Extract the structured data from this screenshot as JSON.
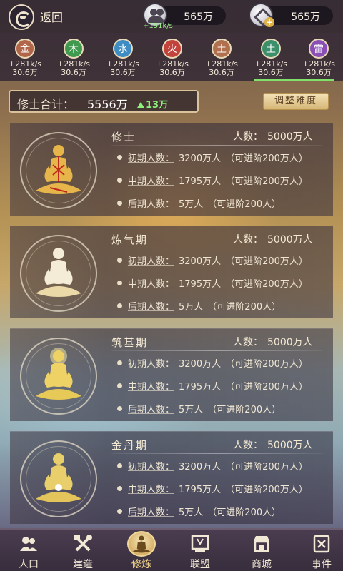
{
  "header": {
    "back_label": "返回",
    "people_value": "565万",
    "people_rate": "+151k/s",
    "coin_value": "565万"
  },
  "elements": [
    {
      "glyph": "金",
      "rate": "+281k/s",
      "value": "30.6万",
      "color": "#b1664a"
    },
    {
      "glyph": "木",
      "rate": "+281k/s",
      "value": "30.6万",
      "color": "#3f9a4f"
    },
    {
      "glyph": "水",
      "rate": "+281k/s",
      "value": "30.6万",
      "color": "#3e8cc4"
    },
    {
      "glyph": "火",
      "rate": "+281k/s",
      "value": "30.6万",
      "color": "#c2433b"
    },
    {
      "glyph": "土",
      "rate": "+281k/s",
      "value": "30.6万",
      "color": "#b06f4e"
    },
    {
      "glyph": "土",
      "rate": "+281k/s",
      "value": "30.6万",
      "color": "#3b8f6a"
    },
    {
      "glyph": "雷",
      "rate": "+281k/s",
      "value": "30.6万",
      "color": "#8a4fb4"
    }
  ],
  "summary": {
    "total_label": "修士合计：",
    "total_value": "5556万",
    "total_increase": "13万",
    "adjust_label": "调整难度"
  },
  "stages": [
    {
      "name": "修士",
      "pop_label": "人数：",
      "pop": "5000万人",
      "rows": [
        {
          "label": "初期人数：",
          "value": "3200万人",
          "note": "（可进阶200万人）"
        },
        {
          "label": "中期人数：",
          "value": "1795万人",
          "note": "（可进阶200万人）"
        },
        {
          "label": "后期人数：",
          "value": "5万人",
          "note": "（可进阶200人）"
        }
      ]
    },
    {
      "name": "炼气期",
      "pop_label": "人数：",
      "pop": "5000万人",
      "rows": [
        {
          "label": "初期人数：",
          "value": "3200万人",
          "note": "（可进阶200万人）"
        },
        {
          "label": "中期人数：",
          "value": "1795万人",
          "note": "（可进阶200万人）"
        },
        {
          "label": "后期人数：",
          "value": "5万人",
          "note": "（可进阶200人）"
        }
      ]
    },
    {
      "name": "筑基期",
      "pop_label": "人数：",
      "pop": "5000万人",
      "rows": [
        {
          "label": "初期人数：",
          "value": "3200万人",
          "note": "（可进阶200万人）"
        },
        {
          "label": "中期人数：",
          "value": "1795万人",
          "note": "（可进阶200万人）"
        },
        {
          "label": "后期人数：",
          "value": "5万人",
          "note": "（可进阶200人）"
        }
      ]
    },
    {
      "name": "金丹期",
      "pop_label": "人数：",
      "pop": "5000万人",
      "rows": [
        {
          "label": "初期人数：",
          "value": "3200万人",
          "note": "（可进阶200万人）"
        },
        {
          "label": "中期人数：",
          "value": "1795万人",
          "note": "（可进阶200万人）"
        },
        {
          "label": "后期人数：",
          "value": "5万人",
          "note": "（可进阶200人）"
        }
      ]
    }
  ],
  "nav": [
    {
      "label": "人口",
      "icon": "people-icon"
    },
    {
      "label": "建造",
      "icon": "tools-icon"
    },
    {
      "label": "修炼",
      "icon": "meditation-icon",
      "active": true
    },
    {
      "label": "联盟",
      "icon": "alliance-icon"
    },
    {
      "label": "商城",
      "icon": "shop-icon"
    },
    {
      "label": "事件",
      "icon": "event-icon"
    }
  ]
}
